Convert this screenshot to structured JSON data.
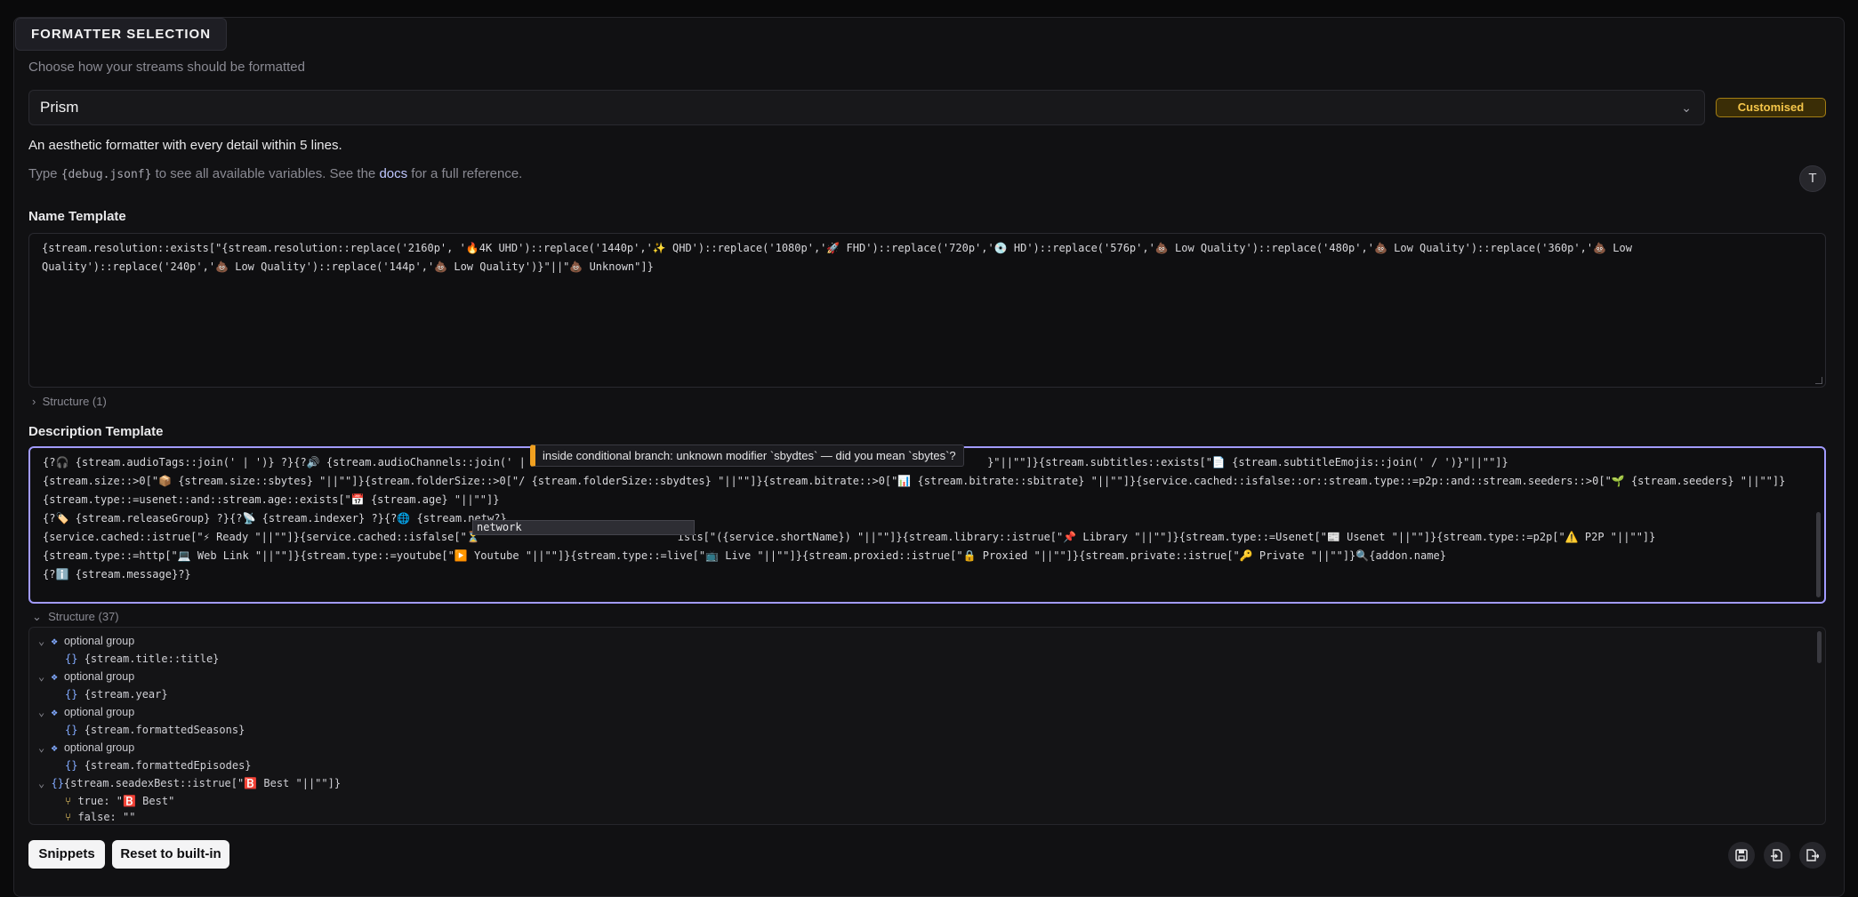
{
  "section": {
    "title": "FORMATTER SELECTION",
    "subtitle": "Choose how your streams should be formatted"
  },
  "formatter": {
    "selected": "Prism",
    "badge": "Customised",
    "description": "An aesthetic formatter with every detail within 5 lines.",
    "hint_prefix": "Type ",
    "hint_code": "{debug.jsonf}",
    "hint_mid": " to see all available variables. See the ",
    "hint_link": "docs",
    "hint_suffix": " for a full reference.",
    "text_button": "T"
  },
  "name_template": {
    "label": "Name Template",
    "lines": [
      "{stream.resolution::exists[\"{stream.resolution::replace('2160p', '🔥4K UHD')::replace('1440p','✨ QHD')::replace('1080p','🚀 FHD')::replace('720p','💿 HD')::replace('576p','💩 Low Quality')::replace('480p','💩 Low Quality')::replace('360p','💩 Low",
      "Quality')::replace('240p','💩 Low Quality')::replace('144p','💩 Low Quality')}\"||\"💩 Unknown\"]}"
    ],
    "structure_toggle": "Structure (1)"
  },
  "description_template": {
    "label": "Description Template",
    "lines": [
      "{?🎧 {stream.audioTags::join(' | ')} ?}{?🔊 {stream.audioChannels::join(' |",
      "{stream.size::>0[\"📦 {stream.size::sbytes} \"||\"\"]}{stream.folderSize::>0[\"/ {stream.folderSize::sbydtes} \"||\"\"]}{stream.bitrate::>0[\"📊 {stream.bitrate::sbitrate} \"||\"\"]}{service.cached::isfalse::or::stream.type::=p2p::and::stream.seeders::>0[\"🌱 {stream.seeders} \"||\"\"]}",
      "{stream.type::=usenet::and::stream.age::exists[\"📅 {stream.age} \"||\"\"]}",
      "{?🏷️ {stream.releaseGroup} ?}{?📡 {stream.indexer} ?}{?🌐 {stream.netw?}",
      "{service.cached::istrue[\"⚡ Ready \"||\"\"]}{service.cached::isfalse[\"⏳",
      "{stream.type::=http[\"💻 Web Link \"||\"\"]}{stream.type::=youtube[\"▶️ Youtube \"||\"\"]}{stream.type::=live[\"📺 Live \"||\"\"]}{stream.proxied::istrue[\"🔒 Proxied \"||\"\"]}{stream.private::istrue[\"🔑 Private \"||\"\"]}🔍{addon.name}",
      "{?ℹ️ {stream.message}?}"
    ],
    "line1_tail": " }\"||\"\"]}{stream.subtitles::exists[\"📄 {stream.subtitleEmojis::join(' / ')}\"||\"\"]}",
    "line5_tail": "ists[\"({service.shortName}) \"||\"\"]}{stream.library::istrue[\"📌 Library \"||\"\"]}{stream.type::=Usenet[\"📰 Usenet \"||\"\"]}{stream.type::=p2p[\"⚠️ P2P \"||\"\"]}",
    "tooltip": "inside conditional branch: unknown modifier `sbydtes` — did you mean `sbytes`?",
    "autocomplete": "network",
    "structure_toggle": "Structure (37)"
  },
  "structure_tree": [
    {
      "type": "group",
      "label": "optional group"
    },
    {
      "type": "leaf",
      "label": "{stream.title::title}"
    },
    {
      "type": "group",
      "label": "optional group"
    },
    {
      "type": "leaf",
      "label": "{stream.year}"
    },
    {
      "type": "group",
      "label": "optional group"
    },
    {
      "type": "leaf",
      "label": "{stream.formattedSeasons}"
    },
    {
      "type": "group",
      "label": "optional group"
    },
    {
      "type": "leaf",
      "label": "{stream.formattedEpisodes}"
    },
    {
      "type": "expr",
      "label": "{stream.seadexBest::istrue[\"🅱️ Best \"||\"\"]}"
    },
    {
      "type": "branch",
      "label": "true: \"🅱️ Best\""
    },
    {
      "type": "branch",
      "label": "false: \"\""
    }
  ],
  "actions": {
    "snippets": "Snippets",
    "reset": "Reset to built-in",
    "icons": [
      "save-icon",
      "import-icon",
      "export-icon"
    ]
  },
  "colors": {
    "accent": "#a29bff",
    "badge": "#f5c64a",
    "warning": "#f0a020"
  }
}
